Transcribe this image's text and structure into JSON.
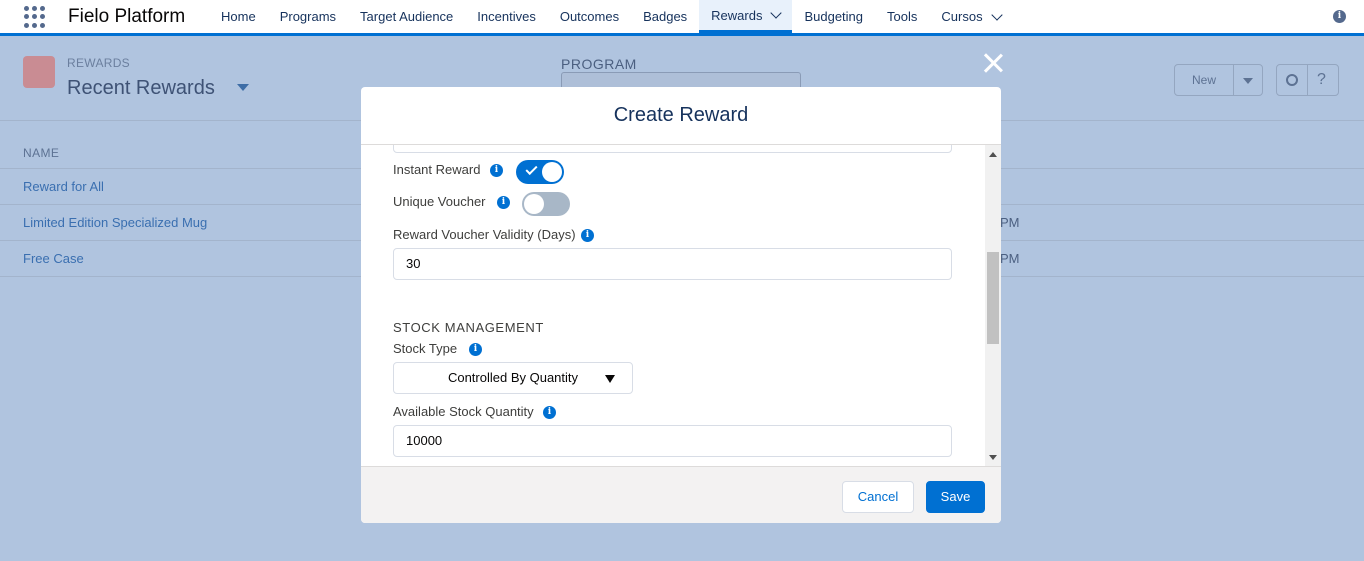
{
  "app": {
    "name": "Fielo Platform"
  },
  "nav": {
    "items": [
      {
        "label": "Home"
      },
      {
        "label": "Programs"
      },
      {
        "label": "Target Audience"
      },
      {
        "label": "Incentives"
      },
      {
        "label": "Outcomes"
      },
      {
        "label": "Badges"
      },
      {
        "label": "Rewards",
        "active": true,
        "dropdown": true
      },
      {
        "label": "Budgeting"
      },
      {
        "label": "Tools"
      },
      {
        "label": "Cursos",
        "dropdown": true
      }
    ]
  },
  "background_page": {
    "eyebrow": "REWARDS",
    "title": "Recent Rewards",
    "program_label": "PROGRAM",
    "new_button": "New",
    "help_icon": "?",
    "column_header": "NAME",
    "rows": [
      {
        "name": "Reward for All",
        "time": ""
      },
      {
        "name": "Limited Edition Specialized Mug",
        "time": "PM"
      },
      {
        "name": "Free Case",
        "time": "PM"
      }
    ]
  },
  "modal": {
    "title": "Create Reward",
    "instant_reward": {
      "label": "Instant Reward",
      "on": true
    },
    "unique_voucher": {
      "label": "Unique Voucher",
      "on": false
    },
    "validity": {
      "label": "Reward Voucher Validity (Days)",
      "value": "30"
    },
    "stock_section": "STOCK MANAGEMENT",
    "stock_type": {
      "label": "Stock Type",
      "value": "Controlled By Quantity"
    },
    "available_stock": {
      "label": "Available Stock Quantity",
      "value": "10000"
    },
    "cancel_label": "Cancel",
    "save_label": "Save"
  },
  "icons": {
    "info": "i",
    "colors": {
      "brand": "#0070d2",
      "overlay": "#b0c4df"
    }
  }
}
